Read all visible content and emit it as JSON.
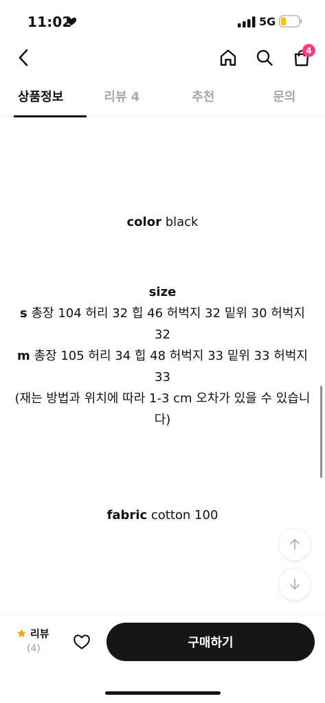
{
  "status_bar": {
    "time": "11:02",
    "network": "5G",
    "heart_icon": "heart-icon",
    "signal_icon": "signal-icon",
    "battery_icon": "battery-icon",
    "battery_level": 0.3,
    "battery_color": "#f5c400"
  },
  "nav": {
    "back_icon": "chevron-left-icon",
    "home_icon": "home-icon",
    "search_icon": "search-icon",
    "cart_icon": "shopping-bag-icon",
    "cart_count": "4",
    "badge_color": "#ff3d7f"
  },
  "tabs": [
    {
      "label": "상품정보",
      "active": true
    },
    {
      "label": "리뷰 4",
      "active": false
    },
    {
      "label": "추천",
      "active": false
    },
    {
      "label": "문의",
      "active": false
    }
  ],
  "content": {
    "color": {
      "key": "color",
      "value": "black"
    },
    "size": {
      "heading": "size",
      "s_key": "s",
      "s_value": "총장 104 허리 32 힙 46 허벅지 32 밑위 30 허벅지 32",
      "m_key": "m",
      "m_value": "총장 105 허리 34 힙 48 허벅지 33 밑위 33 허벅지 33",
      "note": "(재는 방법과 위치에 따라 1-3 cm 오차가 있을 수 있습니다)"
    },
    "fabric": {
      "key": "fabric",
      "value": "cotton 100"
    }
  },
  "float_buttons": {
    "up_icon": "arrow-up-icon",
    "down_icon": "arrow-down-icon"
  },
  "bottom_bar": {
    "review_label": "리뷰",
    "review_count": "(4)",
    "star_icon": "star-icon",
    "star_color": "#f5a623",
    "wish_icon": "heart-outline-icon",
    "buy_label": "구매하기",
    "buy_color": "#161616"
  }
}
